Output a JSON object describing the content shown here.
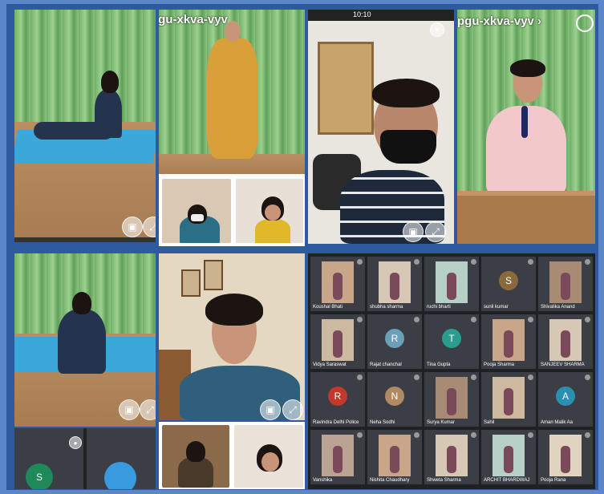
{
  "meeting": {
    "code_top": "pgu-xkva-vyv",
    "code_right": "pgu-xkva-vyv",
    "chevron": "›",
    "status_time": "10:10"
  },
  "panels": {
    "call_center_initial": "S"
  },
  "grid": {
    "tiles": [
      {
        "name": "Koushal Bhati",
        "kind": "video"
      },
      {
        "name": "shubha sharma",
        "kind": "video"
      },
      {
        "name": "ruchi bharti",
        "kind": "video"
      },
      {
        "name": "sunil kumar",
        "kind": "avatar",
        "initial": "S",
        "color": "#8a6a3a"
      },
      {
        "name": "Shivalika Anand",
        "kind": "video"
      },
      {
        "name": "Vidya Saraswat",
        "kind": "video"
      },
      {
        "name": "Rajat chanchal",
        "kind": "avatar",
        "initial": "R",
        "color": "#6aa0b8"
      },
      {
        "name": "Tina Gupta",
        "kind": "avatar",
        "initial": "T",
        "color": "#2a9d8f"
      },
      {
        "name": "Pooja Sharma",
        "kind": "video"
      },
      {
        "name": "SANJEEV SHARMA",
        "kind": "video"
      },
      {
        "name": "Ravindra Delhi Police",
        "kind": "avatar",
        "initial": "R",
        "color": "#c0392b"
      },
      {
        "name": "Neha Sodhi",
        "kind": "avatar",
        "initial": "N",
        "color": "#b08a60"
      },
      {
        "name": "Surya Kumar",
        "kind": "video"
      },
      {
        "name": "Sahil",
        "kind": "video"
      },
      {
        "name": "Aman Malik Aa",
        "kind": "avatar",
        "initial": "A",
        "color": "#2a8fb0"
      },
      {
        "name": "Vanshika",
        "kind": "video"
      },
      {
        "name": "Nishita Chaudhary",
        "kind": "video"
      },
      {
        "name": "Shweta Sharma",
        "kind": "video"
      },
      {
        "name": "ARCHIT BHARDWAJ",
        "kind": "video"
      },
      {
        "name": "Pooja Rana",
        "kind": "video"
      }
    ]
  },
  "colors": {
    "frame": "#2e5aa0",
    "accent_blue": "#1a73e8"
  }
}
